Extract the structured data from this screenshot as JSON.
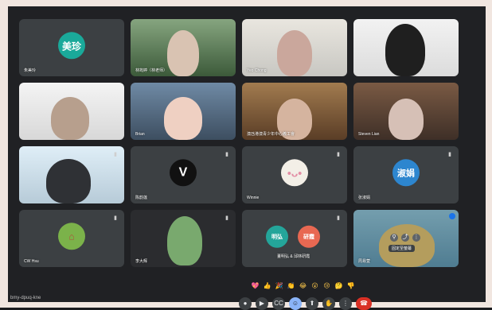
{
  "meeting_code": "bmy-dpuq-kne",
  "tiles": [
    {
      "name": "朱美玲",
      "avatar_text": "美珍",
      "avatar_color": "#1aa99a",
      "type": "avatar"
    },
    {
      "name": "林筠婷（林老师）",
      "type": "video"
    },
    {
      "name": "Yeo Chong",
      "type": "video"
    },
    {
      "name": "",
      "type": "video"
    },
    {
      "name": "",
      "type": "video"
    },
    {
      "name": "Brian",
      "type": "video"
    },
    {
      "name": "澳氹港澳青少年中心義工會",
      "type": "video"
    },
    {
      "name": "Steven Lian",
      "type": "video"
    },
    {
      "name": "",
      "type": "video"
    },
    {
      "name": "陈韵莲",
      "avatar_text": "V",
      "avatar_color": "#111111",
      "type": "avatar"
    },
    {
      "name": "Winnie",
      "avatar_text": "",
      "avatar_color": "#f3efe7",
      "type": "avatar"
    },
    {
      "name": "张淑娟",
      "avatar_text": "淑娟",
      "avatar_color": "#2d86cf",
      "type": "avatar"
    },
    {
      "name": "CW Hsu",
      "avatar_text": "",
      "avatar_color": "#7bb24a",
      "type": "avatar"
    },
    {
      "name": "李大辉",
      "type": "video"
    },
    {
      "name": "董明弘 & 邱林研霞",
      "avatar_text": "明弘",
      "avatar_color": "#24a59a",
      "type": "dual"
    },
    {
      "name": "周易萱",
      "type": "video"
    }
  ],
  "tile_overlay": {
    "button_label": "固定至螢幕"
  },
  "reactions": [
    "💖",
    "👍",
    "🎉",
    "👏",
    "😂",
    "😮",
    "😢",
    "🤔",
    "👎"
  ],
  "controls": [
    {
      "icon": "mic-icon",
      "label": "●"
    },
    {
      "icon": "camera-icon",
      "label": "▶"
    },
    {
      "icon": "captions-icon",
      "label": "CC"
    },
    {
      "icon": "emoji-icon",
      "label": "☺"
    },
    {
      "icon": "present-icon",
      "label": "⬆"
    },
    {
      "icon": "hand-icon",
      "label": "✋"
    },
    {
      "icon": "more-icon",
      "label": "⋮"
    },
    {
      "icon": "leave-icon",
      "label": "☎"
    }
  ]
}
